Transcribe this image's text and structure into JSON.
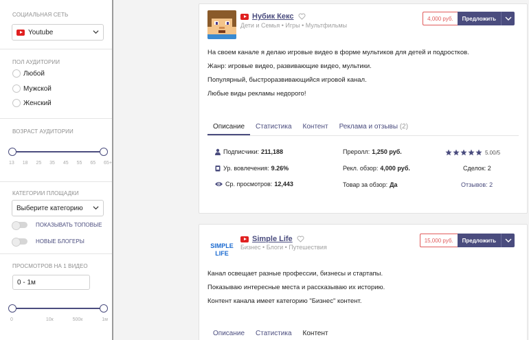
{
  "colors": {
    "accent": "#4a4c7e",
    "price_red": "#e05a5a",
    "youtube_red": "#e02020"
  },
  "sidebar": {
    "social": {
      "title": "СОЦИАЛЬНАЯ СЕТЬ",
      "selected": "Youtube"
    },
    "gender": {
      "title": "ПОЛ АУДИТОРИИ",
      "options": [
        "Любой",
        "Мужской",
        "Женский"
      ]
    },
    "age": {
      "title": "ВОЗРАСТ АУДИТОРИИ",
      "ticks": [
        "13",
        "18",
        "25",
        "35",
        "45",
        "55",
        "65",
        "65+"
      ],
      "min": "13",
      "max": "65+"
    },
    "category": {
      "title": "КАТЕГОРИИ ПЛОЩАДКИ",
      "placeholder": "Выберите категорию",
      "toggle_top": "ПОКАЗЫВАТЬ ТОПОВЫЕ",
      "toggle_new": "НОВЫЕ БЛОГЕРЫ"
    },
    "views": {
      "title": "ПРОСМОТРОВ НА 1 ВИДЕО",
      "value": "0 - 1м",
      "ticks": [
        "0",
        "10к",
        "500к",
        "1м"
      ]
    }
  },
  "cards": [
    {
      "name": "Нубик Кекс",
      "categories": "Дети и Семья • Игры • Мультфильмы",
      "price": "4,000 руб.",
      "offer_label": "Предложить",
      "description": [
        "На своем канале я делаю игровые видео в форме мультиков для детей и подростков.",
        "Жанр: игровые видео, развивающие видео, мультики.",
        "Популярный, быстроразвивающийся игровой канал.",
        "Любые виды рекламы недорого!"
      ],
      "tabs": [
        "Описание",
        "Статистика",
        "Контент",
        "Реклама и отзывы"
      ],
      "reviews_tab_count": "(2)",
      "stats": {
        "subscribers_label": "Подписчики:",
        "subscribers": "211,188",
        "engagement_label": "Ур. вовлечения:",
        "engagement": "9.26%",
        "views_label": "Ср. просмотров:",
        "views": "12,443",
        "preroll_label": "Преролл:",
        "preroll": "1,250 руб.",
        "ad_review_label": "Рекл. обзор:",
        "ad_review": "4,000 руб.",
        "product_label": "Товар за обзор:",
        "product": "Да",
        "rating": "5.00/5",
        "rating_value": 5,
        "deals": "Сделок: 2",
        "reviews": "Отзывов: 2"
      }
    },
    {
      "name": "Simple Life",
      "categories": "Бизнес • Блоги • Путешествия",
      "price": "15,000 руб.",
      "offer_label": "Предложить",
      "logo_text": [
        "SIMPLE",
        "LIFE"
      ],
      "description": [
        "Канал освещает разные профессии, бизнесы и стартапы.",
        "Показываю интересные места и рассказываю их историю.",
        "Контент канала имеет категорию \"Бизнес\" контент."
      ],
      "tabs": [
        "Описание",
        "Статистика",
        "Контент"
      ]
    }
  ]
}
